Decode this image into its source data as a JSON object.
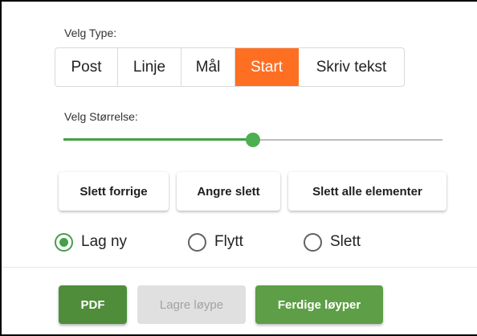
{
  "type_selector": {
    "label": "Velg Type:",
    "options": [
      "Post",
      "Linje",
      "Mål",
      "Start",
      "Skriv tekst"
    ],
    "selected": "Start",
    "active_color": "#ff6f22"
  },
  "size_selector": {
    "label": "Velg Størrelse:",
    "value_fraction": 0.5,
    "accent_color": "#4caf50"
  },
  "actions": {
    "delete_previous": "Slett forrige",
    "undo_delete": "Angre slett",
    "delete_all": "Slett alle elementer"
  },
  "modes": {
    "options": [
      "Lag ny",
      "Flytt",
      "Slett"
    ],
    "selected": "Lag ny"
  },
  "bottom_bar": {
    "pdf": "PDF",
    "save_route": "Lagre løype",
    "save_route_enabled": false,
    "finished_routes": "Ferdige løyper"
  },
  "colors": {
    "green_dark": "#4f8d3b",
    "green": "#5d9e46",
    "disabled": "#e0e0e0"
  }
}
